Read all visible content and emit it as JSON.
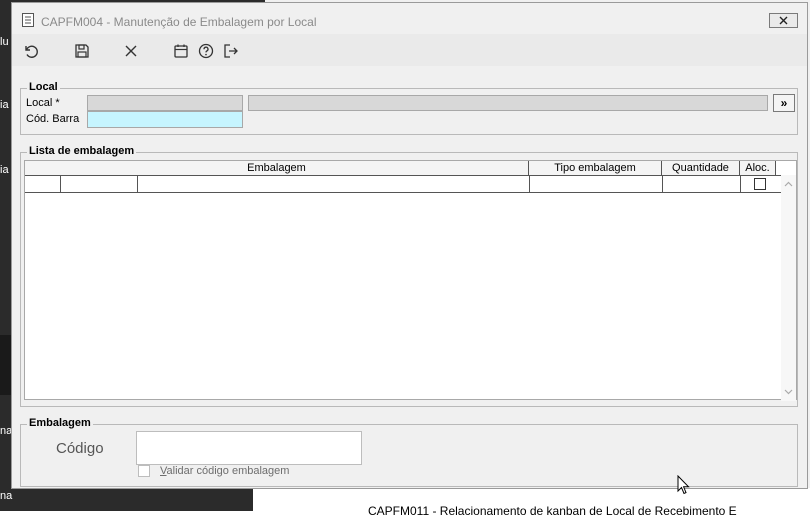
{
  "background": {
    "left_peek": [
      "lu",
      "ia",
      "ia",
      "na",
      "na"
    ],
    "bottom_text": "CAPFM011 - Relacionamento de kanban de Local de Recebimento E"
  },
  "window": {
    "title": "CAPFM004 - Manutenção de Embalagem por Local",
    "toolbar": [
      "undo-icon",
      "save-icon",
      "cancel-icon",
      "calendar-icon",
      "help-icon",
      "exit-icon"
    ]
  },
  "local_group": {
    "title": "Local",
    "local_label": "Local *",
    "local_code": "",
    "local_desc": "",
    "barcode_label": "Cód. Barra",
    "barcode_value": "",
    "search_button": "»"
  },
  "list_group": {
    "title": "Lista de embalagem",
    "columns": [
      "Embalagem",
      "Tipo embalagem",
      "Quantidade",
      "Aloc."
    ]
  },
  "packaging_group": {
    "title": "Embalagem",
    "code_label": "Código",
    "code_value": "",
    "validate_label": "Validar código embalagem",
    "validate_accesskey": "V"
  },
  "colors": {
    "barcode_field": "#c6f5ff",
    "disabled_field": "#d8d8d8",
    "dark_background": "#2b2b2b"
  }
}
